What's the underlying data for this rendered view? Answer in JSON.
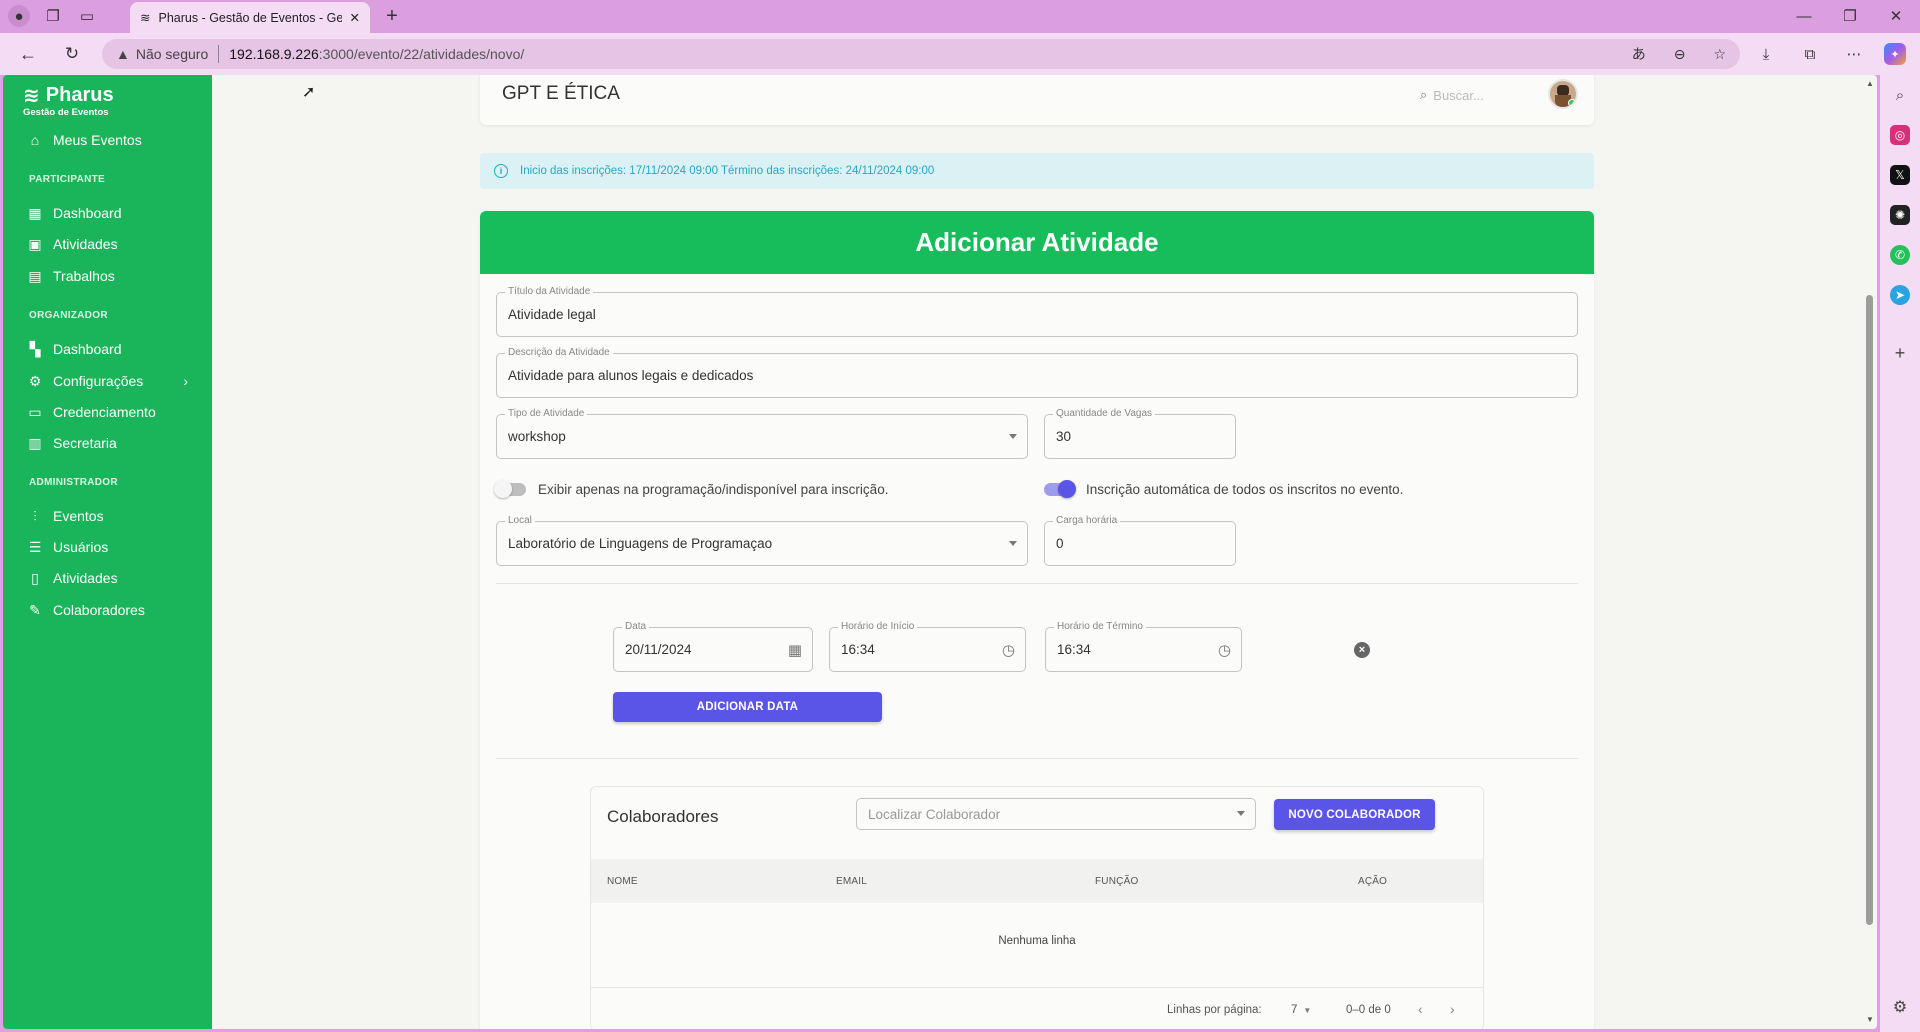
{
  "browser": {
    "tab_title": "Pharus - Gestão de Eventos - Ges",
    "security_label": "Não seguro",
    "url_host": "192.168.9.226",
    "url_path": ":3000/evento/22/atividades/novo/"
  },
  "sidebar": {
    "brand_name": "Pharus",
    "brand_sub": "Gestão de Eventos",
    "top_item": "Meus Eventos",
    "sections": {
      "participante": "PARTICIPANTE",
      "organizador": "ORGANIZADOR",
      "administrador": "ADMINISTRADOR"
    },
    "participante_items": [
      "Dashboard",
      "Atividades",
      "Trabalhos"
    ],
    "organizador_items": [
      "Dashboard",
      "Configurações",
      "Credenciamento",
      "Secretaria"
    ],
    "administrador_items": [
      "Eventos",
      "Usuários",
      "Atividades",
      "Colaboradores"
    ]
  },
  "header": {
    "title": "GPT E ÉTICA",
    "search_placeholder": "Buscar..."
  },
  "info": {
    "text": "Inicio das inscrições: 17/11/2024 09:00 Término das inscrições: 24/11/2024 09:00"
  },
  "form": {
    "heading": "Adicionar Atividade",
    "titulo": {
      "label": "Título da Atividade",
      "value": "Atividade legal"
    },
    "descricao": {
      "label": "Descrição da Atividade",
      "value": "Atividade para alunos legais e dedicados"
    },
    "tipo": {
      "label": "Tipo de Atividade",
      "value": "workshop"
    },
    "vagas": {
      "label": "Quantidade de Vagas",
      "value": "30"
    },
    "toggle_programacao": {
      "label": "Exibir apenas na programação/indisponível para inscrição.",
      "on": false
    },
    "toggle_auto": {
      "label": "Inscrição automática de todos os inscritos no evento.",
      "on": true
    },
    "local": {
      "label": "Local",
      "value": "Laboratório de Linguagens de Programaçao"
    },
    "carga": {
      "label": "Carga horária",
      "value": "0"
    },
    "data": {
      "label": "Data",
      "value": "20/11/2024"
    },
    "inicio": {
      "label": "Horário de Início",
      "value": "16:34"
    },
    "termino": {
      "label": "Horário de Término",
      "value": "16:34"
    },
    "add_date_button": "ADICIONAR DATA"
  },
  "collaborators": {
    "title": "Colaboradores",
    "search_placeholder": "Localizar Colaborador",
    "new_button": "NOVO COLABORADOR",
    "columns": [
      "NOME",
      "EMAIL",
      "FUNÇÃO",
      "AÇÃO"
    ],
    "empty": "Nenhuma linha",
    "rows_per_page_label": "Linhas por página:",
    "rows_per_page": "7",
    "range": "0–0 de 0"
  },
  "colors": {
    "sidebar_green": "#1ab45a",
    "header_green": "#16bd5a",
    "primary_button": "#5b55e7",
    "info_text": "#26a8c4"
  }
}
